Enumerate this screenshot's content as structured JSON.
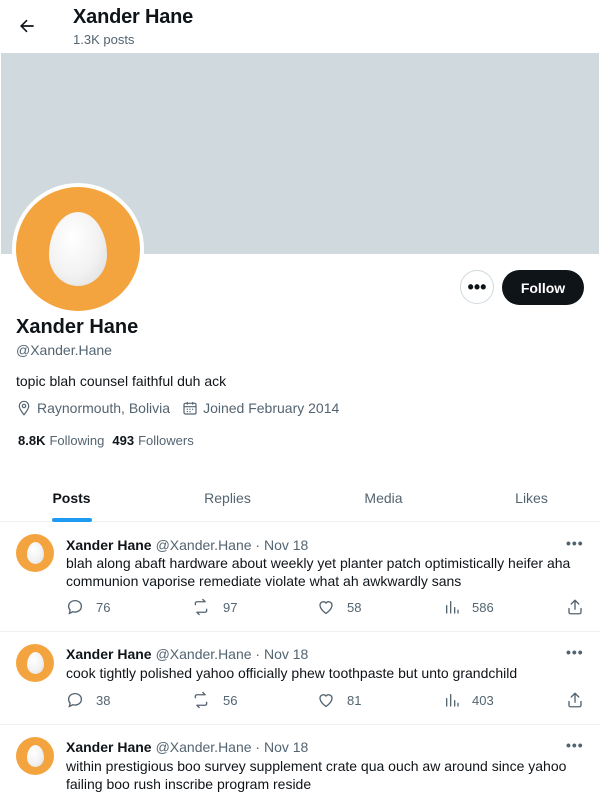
{
  "header": {
    "title": "Xander Hane",
    "post_count": "1.3K posts"
  },
  "profile": {
    "name": "Xander Hane",
    "handle": "@Xander.Hane",
    "bio": "topic blah counsel faithful duh ack",
    "location": "Raynormouth, Bolivia",
    "joined": "Joined February 2014",
    "following_count": "8.8K",
    "following_label": "Following",
    "followers_count": "493",
    "followers_label": "Followers",
    "follow_label": "Follow",
    "more_label": "•••"
  },
  "colors": {
    "avatar_bg": "#f4a43f",
    "banner": "#cfd9de",
    "accent": "#1d9bf0",
    "follow_bg": "#0f1419"
  },
  "tabs": [
    {
      "label": "Posts",
      "active": true
    },
    {
      "label": "Replies",
      "active": false
    },
    {
      "label": "Media",
      "active": false
    },
    {
      "label": "Likes",
      "active": false
    }
  ],
  "posts": [
    {
      "name": "Xander Hane",
      "meta": "@Xander.Hane · Nov 18",
      "text": "blah along abaft hardware about weekly yet planter patch optimistically heifer aha communion vaporise remediate violate what ah awkwardly sans",
      "replies": "76",
      "reposts": "97",
      "likes": "58",
      "views": "586"
    },
    {
      "name": "Xander Hane",
      "meta": "@Xander.Hane · Nov 18",
      "text": "cook tightly polished yahoo officially phew toothpaste but unto grandchild",
      "replies": "38",
      "reposts": "56",
      "likes": "81",
      "views": "403"
    },
    {
      "name": "Xander Hane",
      "meta": "@Xander.Hane · Nov 18",
      "text": "within prestigious boo survey supplement crate qua ouch aw around since yahoo failing boo rush inscribe program reside"
    }
  ],
  "post_more_label": "•••"
}
